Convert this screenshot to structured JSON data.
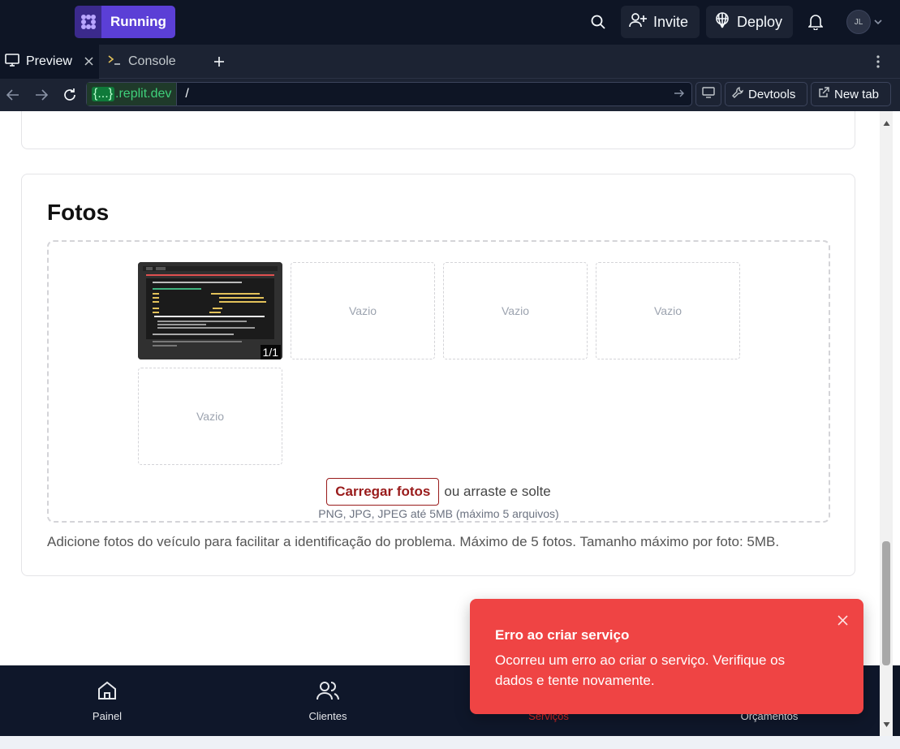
{
  "topbar": {
    "run_label": "Running",
    "invite_label": "Invite",
    "deploy_label": "Deploy",
    "avatar_initials": "JL"
  },
  "tabs": [
    {
      "label": "Preview",
      "icon": "monitor-icon",
      "active": true
    },
    {
      "label": "Console",
      "icon": "terminal-icon",
      "active": false
    }
  ],
  "addressbar": {
    "host_brace": "{...}",
    "host_suffix": ".replit.dev",
    "path": "/",
    "devtools_label": "Devtools",
    "newtab_label": "New tab"
  },
  "photos_section": {
    "title": "Fotos",
    "thumb_counter": "1/1",
    "empty_slot_label": "Vazio",
    "upload_button": "Carregar fotos",
    "upload_or": "ou arraste e solte",
    "formats_hint": "PNG, JPG, JPEG até 5MB (máximo 5 arquivos)",
    "help_text": "Adicione fotos do veículo para facilitar a identificação do problema. Máximo de 5 fotos. Tamanho máximo por foto: 5MB."
  },
  "bottom_nav": {
    "items": [
      {
        "label": "Painel",
        "icon": "home-icon"
      },
      {
        "label": "Clientes",
        "icon": "users-icon"
      },
      {
        "label": "Serviços",
        "icon": "wrench-icon",
        "active": true
      },
      {
        "label": "Orçamentos",
        "icon": "file-icon"
      }
    ]
  },
  "toast": {
    "title": "Erro ao criar serviço",
    "message": "Ocorreu um erro ao criar o serviço. Verifique os dados e tente novamente."
  },
  "colors": {
    "accent_purple": "#5b3fd6",
    "toast_red": "#ef4444",
    "upload_red": "#991b1b",
    "ide_bg": "#0e1525"
  }
}
